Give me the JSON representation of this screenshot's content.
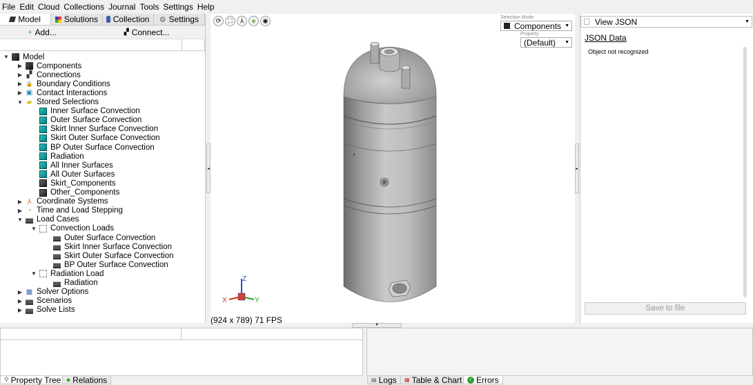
{
  "menu": [
    "File",
    "Edit",
    "Cloud",
    "Collections",
    "Journal",
    "Tools",
    "Settings",
    "Help"
  ],
  "left_tabs": [
    {
      "label": "Model",
      "icon": "model-icon",
      "active": true
    },
    {
      "label": "Solutions",
      "icon": "solutions-icon",
      "active": false
    },
    {
      "label": "Collection",
      "icon": "collection-icon",
      "active": false
    },
    {
      "label": "Settings",
      "icon": "settings-gear-icon",
      "active": false
    }
  ],
  "toolbar": {
    "add_label": "Add...",
    "connect_label": "Connect..."
  },
  "tree": [
    {
      "label": "Model",
      "level": 0,
      "expanded": true,
      "icon": "cube"
    },
    {
      "label": "Components",
      "level": 1,
      "expanded": false,
      "icon": "cube"
    },
    {
      "label": "Connections",
      "level": 1,
      "expanded": false,
      "icon": "connections"
    },
    {
      "label": "Boundary Conditions",
      "level": 1,
      "expanded": false,
      "icon": "lock"
    },
    {
      "label": "Contact Interactions",
      "level": 1,
      "expanded": false,
      "icon": "contact"
    },
    {
      "label": "Stored Selections",
      "level": 1,
      "expanded": true,
      "icon": "folder"
    },
    {
      "label": "Inner Surface Convection",
      "level": 2,
      "icon": "sel"
    },
    {
      "label": "Outer Surface Convection",
      "level": 2,
      "icon": "sel"
    },
    {
      "label": "Skirt Inner Surface Convection",
      "level": 2,
      "icon": "sel"
    },
    {
      "label": "Skirt Outer Surface Convection",
      "level": 2,
      "icon": "sel"
    },
    {
      "label": "BP Outer Surface Convection",
      "level": 2,
      "icon": "sel"
    },
    {
      "label": "Radiation",
      "level": 2,
      "icon": "sel"
    },
    {
      "label": "All Inner Surfaces",
      "level": 2,
      "icon": "sel"
    },
    {
      "label": "All Outer Surfaces",
      "level": 2,
      "icon": "sel"
    },
    {
      "label": "Skirt_Components",
      "level": 2,
      "icon": "dark"
    },
    {
      "label": "Other_Components",
      "level": 2,
      "icon": "dark"
    },
    {
      "label": "Coordinate Systems",
      "level": 1,
      "expanded": false,
      "icon": "axes"
    },
    {
      "label": "Time and Load Stepping",
      "level": 1,
      "expanded": false,
      "icon": "clock"
    },
    {
      "label": "Load Cases",
      "level": 1,
      "expanded": true,
      "icon": "load"
    },
    {
      "label": "Convection Loads",
      "level": 2,
      "expanded": true,
      "icon": "grid"
    },
    {
      "label": "Outer Surface Convection",
      "level": 3,
      "icon": "load"
    },
    {
      "label": "Skirt Inner Surface Convection",
      "level": 3,
      "icon": "load"
    },
    {
      "label": "Skirt Outer Surface Convection",
      "level": 3,
      "icon": "load"
    },
    {
      "label": "BP Outer Surface Convection",
      "level": 3,
      "icon": "load"
    },
    {
      "label": "Radiation Load",
      "level": 2,
      "expanded": true,
      "icon": "grid"
    },
    {
      "label": "Radiation",
      "level": 3,
      "icon": "load"
    },
    {
      "label": "Solver Options",
      "level": 1,
      "expanded": false,
      "icon": "solver"
    },
    {
      "label": "Scenarios",
      "level": 1,
      "expanded": false,
      "icon": "load"
    },
    {
      "label": "Solve Lists",
      "level": 1,
      "expanded": false,
      "icon": "load"
    }
  ],
  "viewport": {
    "selection_mode_label": "Selection Mode",
    "selection_mode_value": "Components",
    "property_label": "Property",
    "property_value": "(Default)",
    "status": "(924 x 789) 71 FPS",
    "triad": {
      "x": "X",
      "y": "Y",
      "z": "Z"
    }
  },
  "right_panel": {
    "view_select": "View JSON",
    "title": "JSON Data",
    "message": "Object not recognized",
    "save_button": "Save to file"
  },
  "bottom_left_tabs": [
    {
      "label": "Property Tree",
      "icon": "search-icon",
      "active": true
    },
    {
      "label": "Relations",
      "icon": "relations-icon",
      "active": false
    }
  ],
  "bottom_right_tabs": [
    {
      "label": "Logs",
      "icon": "logs-icon",
      "active": false
    },
    {
      "label": "Table & Chart",
      "icon": "table-icon",
      "active": false
    },
    {
      "label": "Errors",
      "icon": "check-icon",
      "active": true
    }
  ],
  "colors": {
    "accent_teal": "#1aa5a5",
    "errors_green": "#2a9d2a"
  }
}
